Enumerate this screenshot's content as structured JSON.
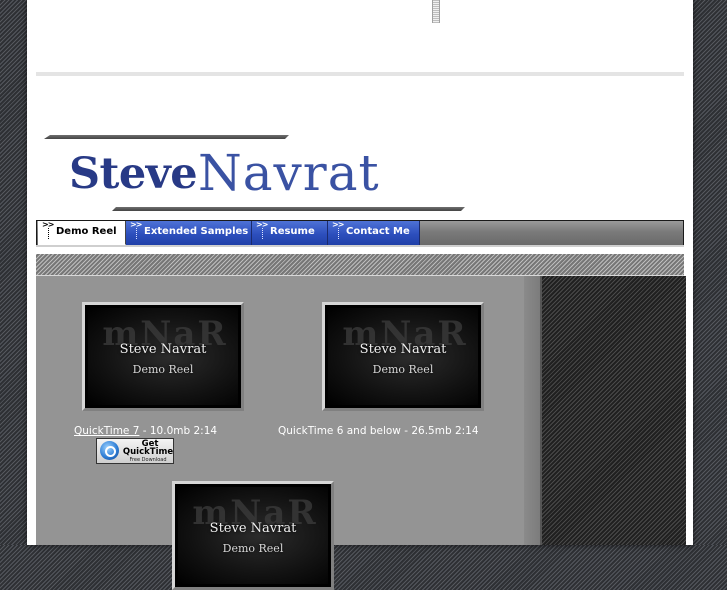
{
  "site": {
    "first_name": "Steve",
    "last_name": "Navrat"
  },
  "nav": {
    "tabs": [
      {
        "label": "Demo Reel",
        "active": true
      },
      {
        "label": "Extended Samples",
        "active": false
      },
      {
        "label": "Resume",
        "active": false
      },
      {
        "label": "Contact Me",
        "active": false
      }
    ]
  },
  "reels": [
    {
      "title": "Steve Navrat",
      "subtitle": "Demo Reel",
      "ghost": "mNaR",
      "caption_link": "QuickTime 7",
      "caption_text": " - 10.0mb  2:14"
    },
    {
      "title": "Steve Navrat",
      "subtitle": "Demo Reel",
      "ghost": "mNaR",
      "caption_text": "QuickTime 6 and below - 26.5mb  2:14"
    },
    {
      "title": "Steve Navrat",
      "subtitle": "Demo Reel",
      "ghost": "mNaR"
    }
  ],
  "quicktime_badge": {
    "line1": "Get",
    "line2": "QuickTime",
    "line3": "Free Download",
    "icon": "quicktime-icon"
  },
  "colors": {
    "brand_blue": "#283a86",
    "tab_blue": "#2d4fbd",
    "content_gray": "#949494"
  }
}
